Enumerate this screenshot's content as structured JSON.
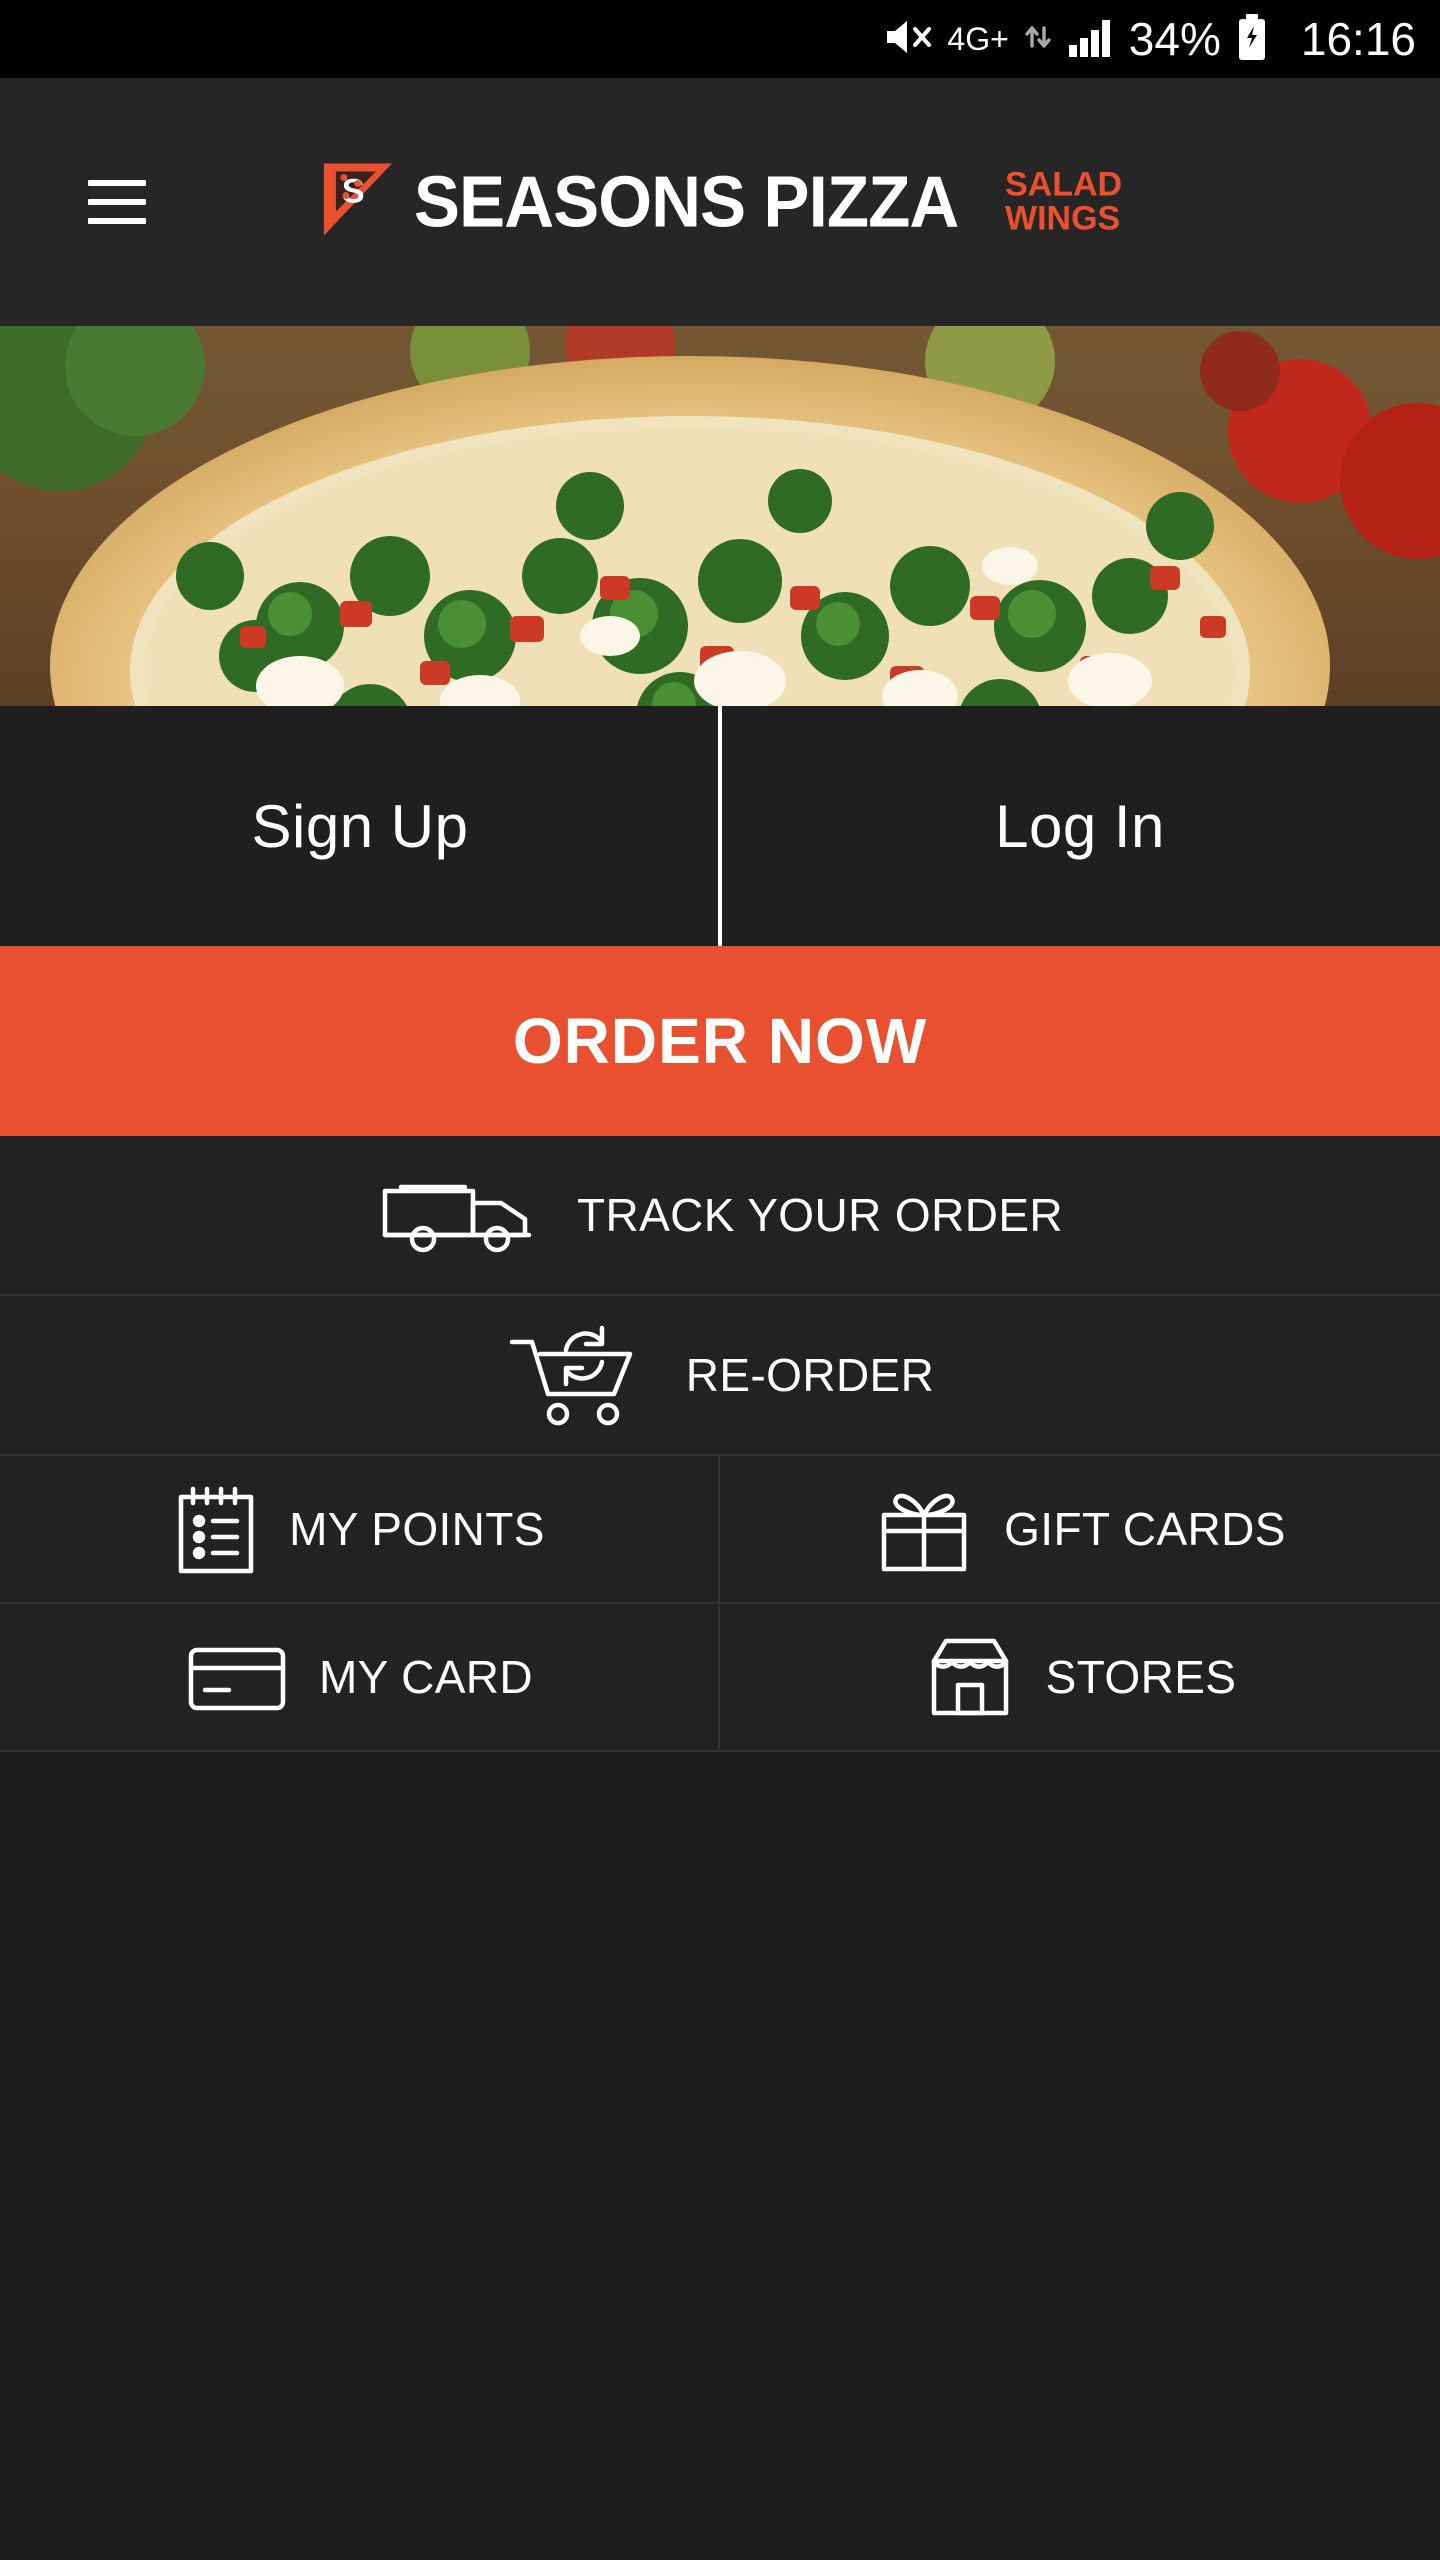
{
  "statusbar": {
    "mute_icon": "mute-icon",
    "network_type": "4G+",
    "data_icon": "data-transfer-icon",
    "signal_icon": "signal-bars-icon",
    "battery_percent": "34%",
    "battery_icon": "battery-charging-icon",
    "clock": "16:16"
  },
  "header": {
    "menu_icon": "hamburger-menu-icon",
    "logo_icon": "pizza-slice-logo-icon",
    "logo_text": "SEASONS PIZZA",
    "logo_sub_line1": "SALAD",
    "logo_sub_line2": "WINGS"
  },
  "hero": {
    "image_alt": "broccoli-tomato-pizza-photo"
  },
  "auth": {
    "sign_up": "Sign Up",
    "log_in": "Log In"
  },
  "cta": {
    "order_now": "ORDER NOW"
  },
  "actions": [
    {
      "label": "TRACK YOUR ORDER",
      "icon": "delivery-truck-icon"
    },
    {
      "label": "RE-ORDER",
      "icon": "reorder-cart-icon"
    }
  ],
  "grid": [
    {
      "label": "MY POINTS",
      "icon": "notepad-points-icon"
    },
    {
      "label": "GIFT CARDS",
      "icon": "gift-box-icon"
    },
    {
      "label": "MY CARD",
      "icon": "credit-card-icon"
    },
    {
      "label": "STORES",
      "icon": "storefront-icon"
    }
  ],
  "colors": {
    "accent": "#e8502f",
    "header_bg": "#262626",
    "page_bg": "#222222",
    "text": "#ffffff"
  }
}
